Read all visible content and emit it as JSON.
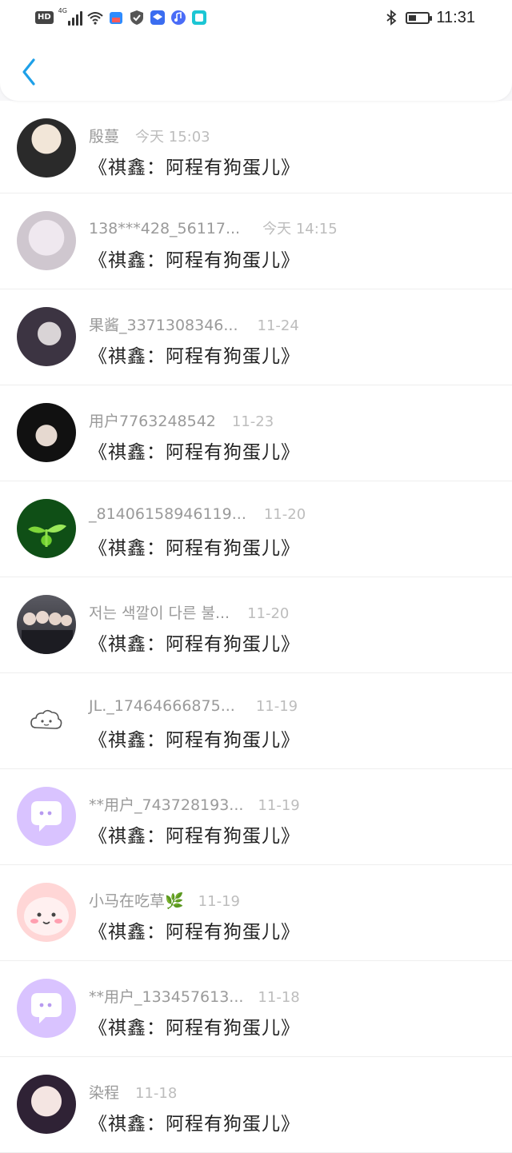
{
  "status_bar": {
    "network_label": "HD",
    "network_type": "4G",
    "time": "11:31",
    "icons": [
      "signal-icon",
      "wifi-icon",
      "app-icon-1",
      "shield-icon",
      "app-icon-2",
      "music-icon",
      "app-icon-3",
      "bluetooth-icon",
      "battery-icon"
    ]
  },
  "header": {
    "back_icon": "chevron-left-icon",
    "accent": "#1ea0e8"
  },
  "items": [
    {
      "name": "殷蔓",
      "time": "今天 15:03",
      "message": "《祺鑫：阿程有狗蛋儿》",
      "avatar": "avatar-photo"
    },
    {
      "name": "138***428_56117...",
      "time": "今天 14:15",
      "message": "《祺鑫：阿程有狗蛋儿》",
      "avatar": "avatar-photo"
    },
    {
      "name": "果酱_3371308346...",
      "time": "11-24",
      "message": "《祺鑫：阿程有狗蛋儿》",
      "avatar": "avatar-photo"
    },
    {
      "name": "用户7763248542",
      "time": "11-23",
      "message": "《祺鑫：阿程有狗蛋儿》",
      "avatar": "avatar-photo"
    },
    {
      "name": "_81406158946119...",
      "time": "11-20",
      "message": "《祺鑫：阿程有狗蛋儿》",
      "avatar": "avatar-sprout"
    },
    {
      "name": "저는 색깔이 다른 불...",
      "time": "11-20",
      "message": "《祺鑫：阿程有狗蛋儿》",
      "avatar": "avatar-photo"
    },
    {
      "name": "JL._17464666875...",
      "time": "11-19",
      "message": "《祺鑫：阿程有狗蛋儿》",
      "avatar": "avatar-cloud-face"
    },
    {
      "name": "**用户_743728193...",
      "time": "11-19",
      "message": "《祺鑫：阿程有狗蛋儿》",
      "avatar": "avatar-chat-bubble"
    },
    {
      "name": "小马在吃草🌿",
      "time": "11-19",
      "message": "《祺鑫：阿程有狗蛋儿》",
      "avatar": "avatar-pink-face"
    },
    {
      "name": "**用户_133457613...",
      "time": "11-18",
      "message": "《祺鑫：阿程有狗蛋儿》",
      "avatar": "avatar-chat-bubble"
    },
    {
      "name": "染程",
      "time": "11-18",
      "message": "《祺鑫：阿程有狗蛋儿》",
      "avatar": "avatar-photo"
    }
  ]
}
